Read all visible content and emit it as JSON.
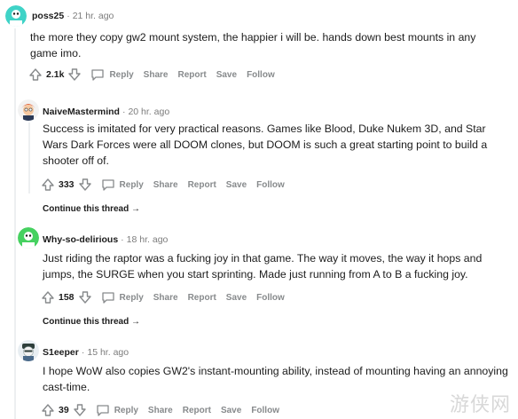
{
  "comments": [
    {
      "username": "poss25",
      "time": "21 hr. ago",
      "text": "the more they copy gw2 mount system, the happier i will be. hands down best mounts in any game imo.",
      "score": "2.1k",
      "reply": "Reply",
      "share": "Share",
      "report": "Report",
      "save": "Save",
      "follow": "Follow"
    },
    {
      "username": "NaiveMastermind",
      "time": "20 hr. ago",
      "text": "Success is imitated for very practical reasons. Games like Blood, Duke Nukem 3D, and Star Wars Dark Forces were all DOOM clones, but DOOM is such a great starting point to build a shooter off of.",
      "score": "333",
      "reply": "Reply",
      "share": "Share",
      "report": "Report",
      "save": "Save",
      "follow": "Follow",
      "continue": "Continue this thread"
    },
    {
      "username": "Why-so-delirious",
      "time": "18 hr. ago",
      "text": "Just riding the raptor was a fucking joy in that game. The way it moves, the way it hops and jumps, the SURGE when you start sprinting. Made just running from A to B a fucking joy.",
      "score": "158",
      "reply": "Reply",
      "share": "Share",
      "report": "Report",
      "save": "Save",
      "follow": "Follow",
      "continue": "Continue this thread"
    },
    {
      "username": "S1eeper",
      "time": "15 hr. ago",
      "text": "I hope WoW also copies GW2's instant-mounting ability, instead of mounting having an annoying cast-time.",
      "score": "39",
      "reply": "Reply",
      "share": "Share",
      "report": "Report",
      "save": "Save",
      "follow": "Follow"
    }
  ],
  "watermark": "游侠网"
}
